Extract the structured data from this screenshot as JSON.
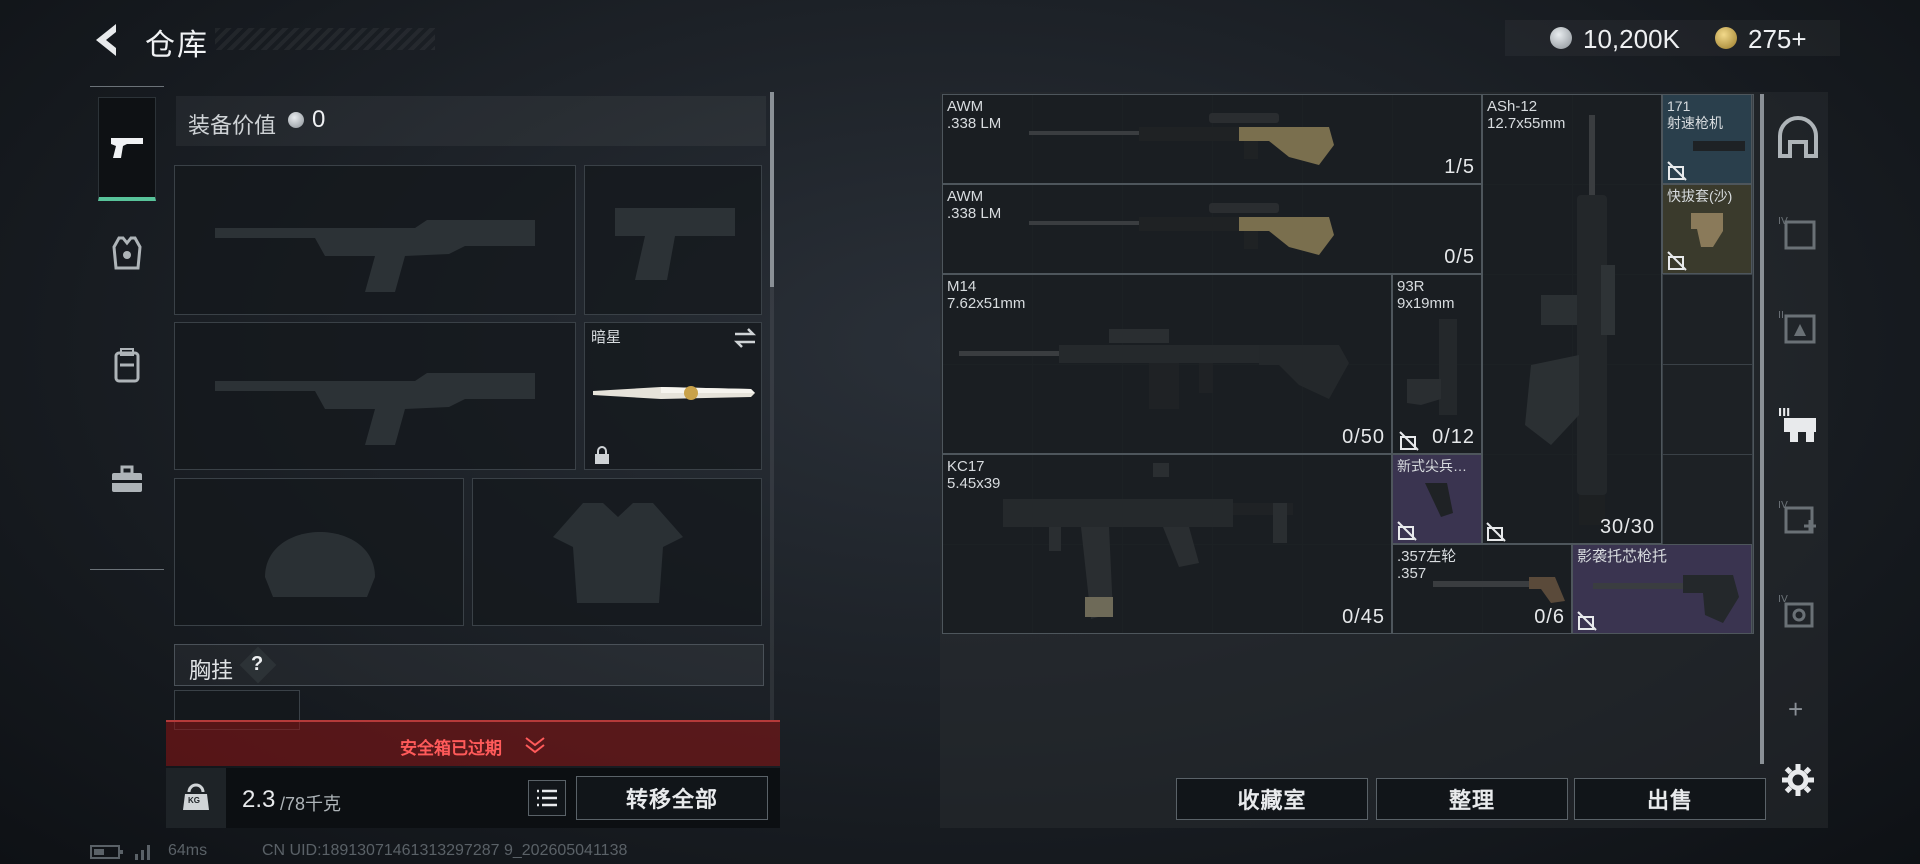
{
  "header": {
    "title": "仓库"
  },
  "currency": {
    "silver": "10,200K",
    "gold": "275+"
  },
  "equipment": {
    "value_label": "装备价值",
    "value": "0",
    "melee_name": "暗星",
    "vest_label": "胸挂",
    "vest_help": "?",
    "safe_box_status": "安全箱已过期",
    "weight_current": "2.3",
    "weight_max": "/78千克",
    "weight_icon_label": "KG",
    "transfer_all": "转移全部"
  },
  "stash": {
    "items": [
      {
        "name": "AWM\n.338 LM",
        "count": "1/5"
      },
      {
        "name": "AWM\n.338 LM",
        "count": "0/5"
      },
      {
        "name": "ASh-12\n12.7x55mm",
        "count": "30/30"
      },
      {
        "name": "171\n射速枪机",
        "count": ""
      },
      {
        "name": "快拔套(沙)",
        "count": ""
      },
      {
        "name": "M14\n7.62x51mm",
        "count": "0/50"
      },
      {
        "name": "93R\n9x19mm",
        "count": "0/12"
      },
      {
        "name": "KC17\n5.45x39",
        "count": "0/45"
      },
      {
        "name": "新式尖兵…",
        "count": ""
      },
      {
        "name": ".357左轮\n.357",
        "count": "0/6"
      },
      {
        "name": "影袭托芯枪托",
        "count": ""
      }
    ],
    "buttons": {
      "collection": "收藏室",
      "sort": "整理",
      "sell": "出售"
    }
  },
  "side": {
    "add": "+"
  },
  "status_bar": {
    "ping": "64ms",
    "uid": "CN UID:18913071461313297287 9_202605041138"
  },
  "colors": {
    "accent_green": "#58c39a",
    "warning_red": "#d23a3a",
    "rare_purple": "#3a3450",
    "rare_blue": "#2a3f4c",
    "common_tan": "#3a3a2c"
  }
}
